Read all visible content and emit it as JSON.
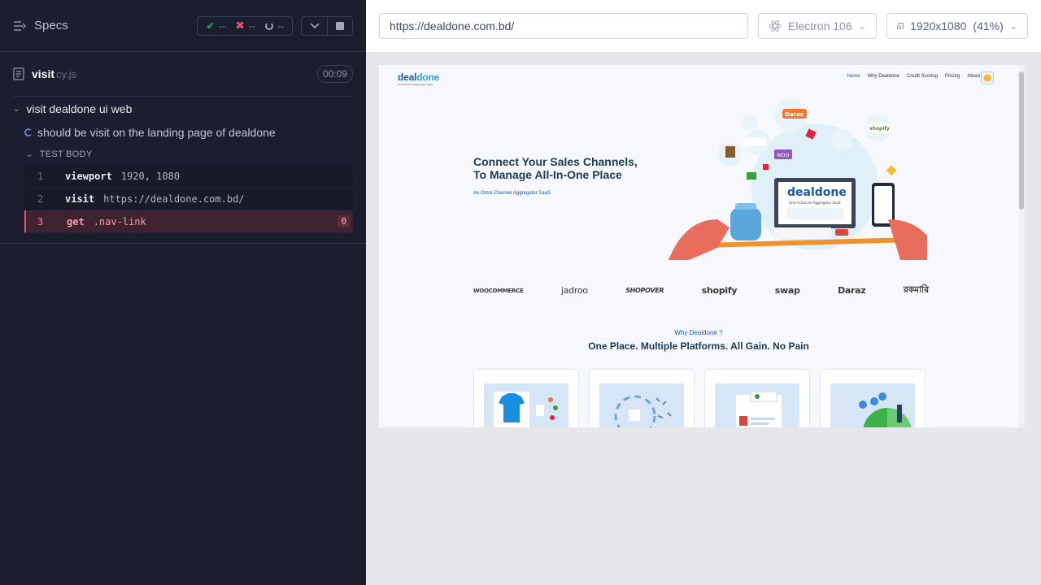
{
  "runner": {
    "specs_label": "Specs",
    "stats": {
      "passed": "--",
      "failed": "--",
      "pending": "--"
    },
    "spec": {
      "name": "visit",
      "ext": "cy.js",
      "duration": "00:09"
    },
    "suite": {
      "title": "visit dealdone ui web"
    },
    "test": {
      "title": "should be visit on the landing page of dealdone",
      "body_label": "TEST BODY"
    },
    "commands": [
      {
        "num": "1",
        "name": "viewport",
        "message": "1920, 1080",
        "state": "passed"
      },
      {
        "num": "2",
        "name": "visit",
        "message": "https://dealdone.com.bd/",
        "state": "passed"
      },
      {
        "num": "3",
        "name": "get",
        "message": ".nav-link",
        "state": "failed",
        "count": "0"
      }
    ]
  },
  "aut": {
    "url": "https://dealdone.com.bd/",
    "browser": "Electron 106",
    "viewport": "1920x1080",
    "scale": "(41%)"
  },
  "site": {
    "logo": {
      "part1": "deal",
      "part2": "done",
      "tagline": "Omni-Channel Aggregator SaaS"
    },
    "nav": [
      "Home",
      "Why Dealdone",
      "Credit Scoring",
      "Pricing",
      "About Us"
    ],
    "hero": {
      "title_line1": "Connect Your Sales Channels,",
      "title_line2": "To Manage All-In-One Place",
      "subtitle": "An Omni-Channel Aggregator SaaS",
      "laptop_logo": "dealdone",
      "laptop_tag": "Omni-Channel Aggregator SaaS"
    },
    "brands": [
      "WOOCOMMERCE",
      "jadroo",
      "SHOPOVER",
      "shopify",
      "swap",
      "Daraz",
      "রকমারি"
    ],
    "why": {
      "label": "Why Dealdone ?",
      "title": "One Place. Multiple Platforms. All Gain. No Pain"
    }
  },
  "colors": {
    "runner_bg": "#1b1e2e",
    "pass": "#1fa971",
    "fail": "#e45770",
    "brand_blue": "#1a5aa8"
  }
}
